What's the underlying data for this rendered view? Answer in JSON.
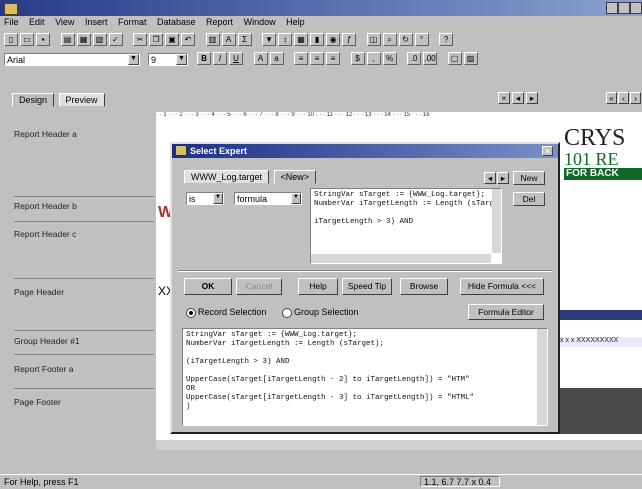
{
  "menu": [
    "File",
    "Edit",
    "View",
    "Insert",
    "Format",
    "Database",
    "Report",
    "Window",
    "Help"
  ],
  "font_box": {
    "font": "Arial",
    "size": "9"
  },
  "format_buttons": [
    "B",
    "I",
    "U"
  ],
  "tabs": [
    {
      "label": "Design"
    },
    {
      "label": "Preview"
    }
  ],
  "sections": [
    {
      "label": "Report Header a"
    },
    {
      "label": "Report Header b"
    },
    {
      "label": "Report Header c"
    },
    {
      "label": "Page Header"
    },
    {
      "label": "Group Header #1"
    },
    {
      "label": "Report Footer a"
    },
    {
      "label": "Page Footer"
    }
  ],
  "ruler_text": "· · 1 · · · 2 · · · 3 · · · 4 · · · 5 · · · 6 · · · 7 · · · 8 · · · 9 · · · 10 · · · 11 · · · 12 · · · 13 · · · 14 · · · 15 · · · 16",
  "banner": {
    "line1": "CRYS",
    "line2": "101 RE",
    "line3": "FOR BACK"
  },
  "canvas_fragments": {
    "xx": "XX",
    "w": "W",
    "pattern": "x x x XXXXXXXXX"
  },
  "dialog": {
    "title": "Select Expert",
    "tabs": [
      {
        "label": "WWW_Log.target"
      },
      {
        "label": "<New>"
      }
    ],
    "new_button": "New",
    "del_button": "Del",
    "operator": "is",
    "mode": "formula",
    "formula_preview": "StringVar sTarget := {WWW_Log.target};\nNumberVar iTargetLength := Length (sTarget);\n\niTargetLength > 3) AND",
    "buttons": {
      "ok": "OK",
      "cancel": "Cancel",
      "help": "Help",
      "speed_tip": "Speed Tip",
      "browse": "Browse",
      "hide_formula": "Hide Formula <<<"
    },
    "radio": {
      "record": "Record Selection",
      "group": "Group Selection"
    },
    "formula_editor": "Formula Editor",
    "formula_full": "StringVar sTarget := {WWW_Log.target};\nNumberVar iTargetLength := Length (sTarget);\n\n(iTargetLength > 3) AND\n\nUpperCase(sTarget[iTargetLength - 2] to iTargetLength]) = \"HTM\"\nOR\nUpperCase(sTarget[iTargetLength - 3] to iTargetLength]) = \"HTML\"\n)"
  },
  "status": {
    "help": "For Help, press F1",
    "coords": "1.1, 6.7  7.7 x 0.4"
  }
}
